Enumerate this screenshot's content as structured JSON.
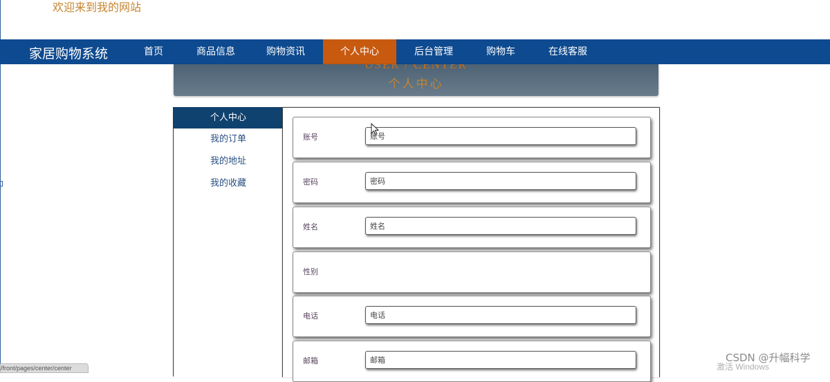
{
  "header": {
    "welcome": "欢迎来到我的网站"
  },
  "navbar": {
    "brand": "家居购物系统",
    "items": [
      {
        "label": "首页",
        "active": false
      },
      {
        "label": "商品信息",
        "active": false
      },
      {
        "label": "购物资讯",
        "active": false
      },
      {
        "label": "个人中心",
        "active": true
      },
      {
        "label": "后台管理",
        "active": false
      },
      {
        "label": "购物车",
        "active": false
      },
      {
        "label": "在线客服",
        "active": false
      }
    ]
  },
  "banner": {
    "title_en": "USER / CENTER",
    "title_cn": "个人中心"
  },
  "sidebar": {
    "items": [
      {
        "label": "个人中心",
        "active": true
      },
      {
        "label": "我的订单",
        "active": false
      },
      {
        "label": "我的地址",
        "active": false
      },
      {
        "label": "我的收藏",
        "active": false
      }
    ]
  },
  "form": {
    "rows": [
      {
        "label": "账号",
        "placeholder": "账号"
      },
      {
        "label": "密码",
        "placeholder": "密码"
      },
      {
        "label": "姓名",
        "placeholder": "姓名"
      },
      {
        "label": "性别"
      },
      {
        "label": "电话",
        "placeholder": "电话"
      },
      {
        "label": "邮箱",
        "placeholder": "邮箱"
      }
    ]
  },
  "status_bar": {
    "url": "/front/pages/center/center"
  },
  "watermarks": {
    "activate": "激活 Windows",
    "csdn": "CSDN @升幅科学"
  },
  "colors": {
    "navbar": "#0e4a8f",
    "nav_active": "#c85a10",
    "sidebar_active": "#10426f",
    "accent_text": "#c6842e"
  }
}
